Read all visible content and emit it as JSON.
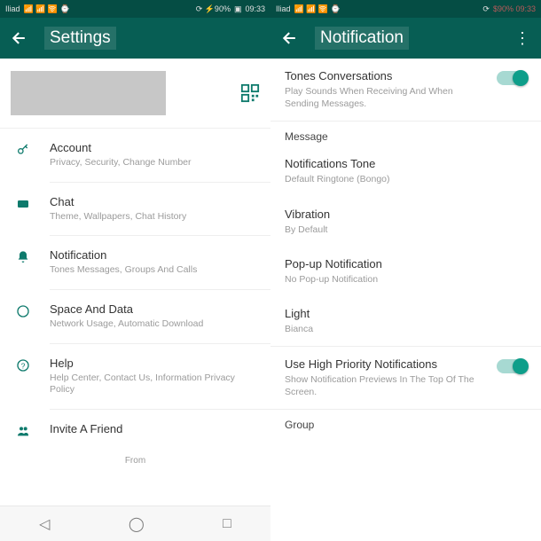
{
  "status": {
    "carrier": "Iliad",
    "signal_icons": "📶 📶 🛜 ⌚",
    "nfc_bt_batt": "⟳ ⚡90%",
    "batt_icon": "▣",
    "time": "09:33",
    "right_carrier": "Iliad",
    "right_nfc": "⟳",
    "right_batt": "$90% 09:33"
  },
  "left": {
    "title": "Settings",
    "items": [
      {
        "icon": "key",
        "title": "Account",
        "sub": "Privacy, Security, Change Number"
      },
      {
        "icon": "chat",
        "title": "Chat",
        "sub": "Theme, Wallpapers, Chat History"
      },
      {
        "icon": "bell",
        "title": "Notification",
        "sub": "Tones Messages, Groups And Calls"
      },
      {
        "icon": "data",
        "title": "Space And Data",
        "sub": "Network Usage, Automatic Download"
      },
      {
        "icon": "help",
        "title": "Help",
        "sub": "Help Center, Contact Us, Information Privacy Policy"
      },
      {
        "icon": "invite",
        "title": "Invite A Friend",
        "sub": ""
      }
    ],
    "from": "From"
  },
  "right": {
    "title": "Notification",
    "tones": {
      "title": "Tones Conversations",
      "sub": "Play Sounds When Receiving And When Sending Messages."
    },
    "section_message": "Message",
    "rows": [
      {
        "title": "Notifications Tone",
        "sub": "Default Ringtone (Bongo)"
      },
      {
        "title": "Vibration",
        "sub": "By Default"
      },
      {
        "title": "Pop-up Notification",
        "sub": "No Pop-up Notification"
      },
      {
        "title": "Light",
        "sub": "Bianca"
      }
    ],
    "highpri": {
      "title": "Use High Priority Notifications",
      "sub": "Show Notification Previews In The Top Of The Screen."
    },
    "section_group": "Group"
  },
  "nav": {
    "back": "◁",
    "home": "◯",
    "recent": "□"
  }
}
